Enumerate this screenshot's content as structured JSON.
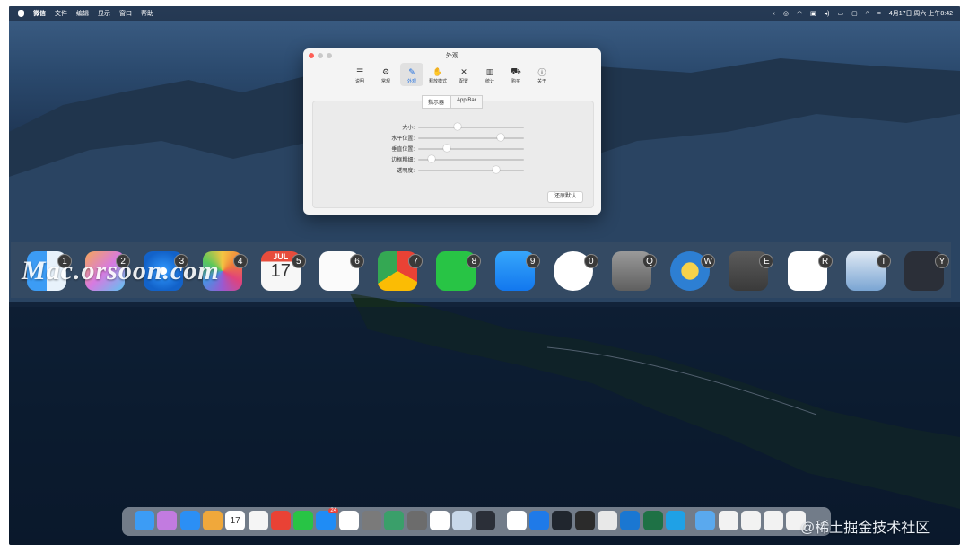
{
  "menubar": {
    "app_name": "微信",
    "menus": [
      "文件",
      "编辑",
      "显示",
      "窗口",
      "帮助"
    ],
    "datetime": "4月17日 周六 上午8:42"
  },
  "window": {
    "title": "外观",
    "tabs": [
      {
        "label": "说明",
        "icon": "sliders-icon"
      },
      {
        "label": "常规",
        "icon": "gear-icon"
      },
      {
        "label": "外观",
        "icon": "paintbrush-icon",
        "active": true
      },
      {
        "label": "释放模式",
        "icon": "hand-icon"
      },
      {
        "label": "配置",
        "icon": "tools-icon"
      },
      {
        "label": "统计",
        "icon": "chart-icon"
      },
      {
        "label": "购买",
        "icon": "cart-icon"
      },
      {
        "label": "关于",
        "icon": "info-icon"
      }
    ],
    "segments": [
      "指示器",
      "App Bar"
    ],
    "sliders": [
      {
        "label": "大小:",
        "value": 0.37
      },
      {
        "label": "水平位置:",
        "value": 0.78
      },
      {
        "label": "垂直位置:",
        "value": 0.27
      },
      {
        "label": "边框粗细:",
        "value": 0.13
      },
      {
        "label": "透明度:",
        "value": 0.74
      }
    ],
    "reset_label": "还原默认"
  },
  "switcher": {
    "watermark": "Mac.orsoon.com",
    "apps": [
      {
        "key": "1",
        "name": "Finder",
        "icon": "finder-icon"
      },
      {
        "key": "2",
        "name": "Launchpad",
        "icon": "launchpad-icon"
      },
      {
        "key": "3",
        "name": "Safari",
        "icon": "safari-icon"
      },
      {
        "key": "4",
        "name": "Photos",
        "icon": "photos-icon"
      },
      {
        "key": "5",
        "name": "Calendar",
        "icon": "calendar-icon",
        "month": "JUL",
        "day": "17"
      },
      {
        "key": "6",
        "name": "Reminders",
        "icon": "reminders-icon"
      },
      {
        "key": "7",
        "name": "Chrome",
        "icon": "chrome-icon"
      },
      {
        "key": "8",
        "name": "WeChat",
        "icon": "wechat-icon"
      },
      {
        "key": "9",
        "name": "App Store",
        "icon": "appstore-icon"
      },
      {
        "key": "0",
        "name": "Dots",
        "icon": "dots-icon"
      },
      {
        "key": "Q",
        "name": "System Preferences",
        "icon": "gear-icon"
      },
      {
        "key": "W",
        "name": "Weather",
        "icon": "weather-icon"
      },
      {
        "key": "E",
        "name": "Cloud",
        "icon": "cloud-icon"
      },
      {
        "key": "R",
        "name": "Notion",
        "icon": "notion-icon"
      },
      {
        "key": "T",
        "name": "Preview",
        "icon": "preview-icon"
      },
      {
        "key": "Y",
        "name": "Editor",
        "icon": "editor-icon"
      }
    ]
  },
  "dock": {
    "calendar_day": "17",
    "appstore_badge": "24"
  },
  "credit": "@稀土掘金技术社区",
  "colors": {
    "accent": "#1f6fe0",
    "close": "#fe5f57",
    "minimize": "#febc2e",
    "zoom": "#28c840"
  }
}
